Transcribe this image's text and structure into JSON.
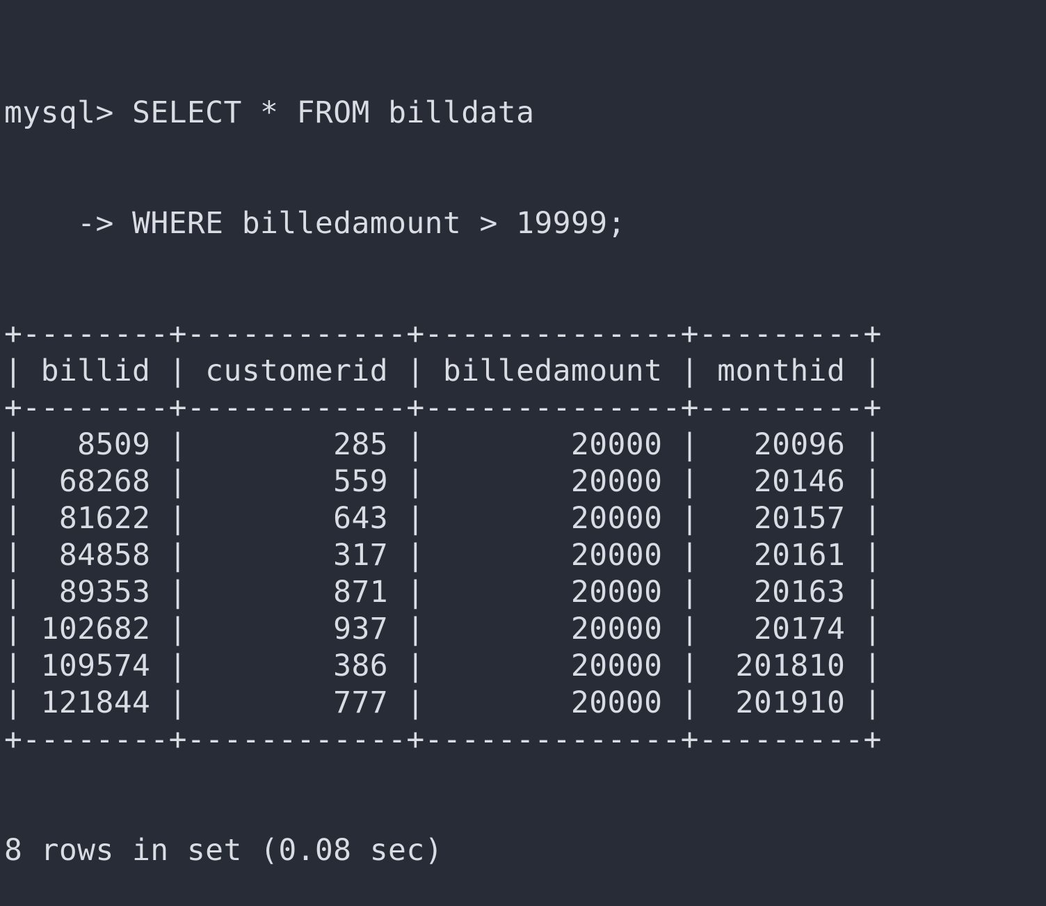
{
  "terminal": {
    "prompt": "mysql> ",
    "query_line1": "SELECT * FROM billdata",
    "continuation_prompt": "    -> ",
    "query_line2": "WHERE billedamount > 19999;"
  },
  "table": {
    "columns": [
      "billid",
      "customerid",
      "billedamount",
      "monthid"
    ],
    "rows": [
      [
        "8509",
        "285",
        "20000",
        "20096"
      ],
      [
        "68268",
        "559",
        "20000",
        "20146"
      ],
      [
        "81622",
        "643",
        "20000",
        "20157"
      ],
      [
        "84858",
        "317",
        "20000",
        "20161"
      ],
      [
        "89353",
        "871",
        "20000",
        "20163"
      ],
      [
        "102682",
        "937",
        "20000",
        "20174"
      ],
      [
        "109574",
        "386",
        "20000",
        "201810"
      ],
      [
        "121844",
        "777",
        "20000",
        "201910"
      ]
    ]
  },
  "footer": {
    "summary": "8 rows in set (0.08 sec)"
  },
  "colors": {
    "background": "#282c36",
    "text": "#d9dce3"
  }
}
